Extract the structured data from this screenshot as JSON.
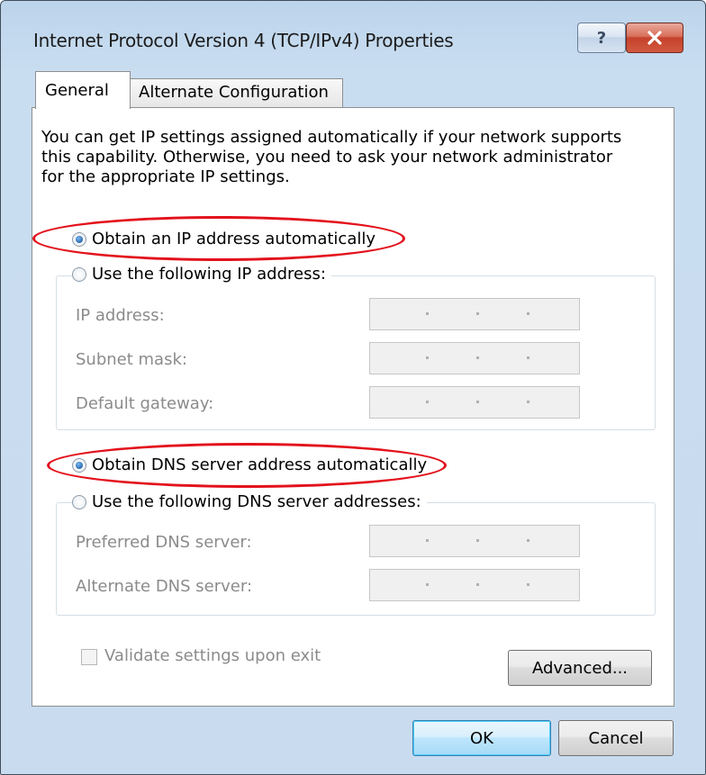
{
  "window": {
    "title": "Internet Protocol Version 4 (TCP/IPv4) Properties",
    "help_button": "?",
    "close_icon": "close-icon"
  },
  "tabs": [
    {
      "label": "General",
      "active": true
    },
    {
      "label": "Alternate Configuration",
      "active": false
    }
  ],
  "description": "You can get IP settings assigned automatically if your network supports this capability. Otherwise, you need to ask your network administrator for the appropriate IP settings.",
  "ip": {
    "auto_label": "Obtain an IP address automatically",
    "auto_selected": true,
    "manual_label": "Use the following IP address:",
    "fields": [
      {
        "label": "IP address:",
        "value": ". . ."
      },
      {
        "label": "Subnet mask:",
        "value": ". . ."
      },
      {
        "label": "Default gateway:",
        "value": ". . ."
      }
    ]
  },
  "dns": {
    "auto_label": "Obtain DNS server address automatically",
    "auto_selected": true,
    "manual_label": "Use the following DNS server addresses:",
    "fields": [
      {
        "label": "Preferred DNS server:",
        "value": ". . ."
      },
      {
        "label": "Alternate DNS server:",
        "value": ". . ."
      }
    ]
  },
  "validate": {
    "label": "Validate settings upon exit",
    "checked": false
  },
  "buttons": {
    "advanced": "Advanced...",
    "ok": "OK",
    "cancel": "Cancel"
  },
  "colors": {
    "highlight": "#e3111c",
    "accent": "#1f5fa5"
  }
}
